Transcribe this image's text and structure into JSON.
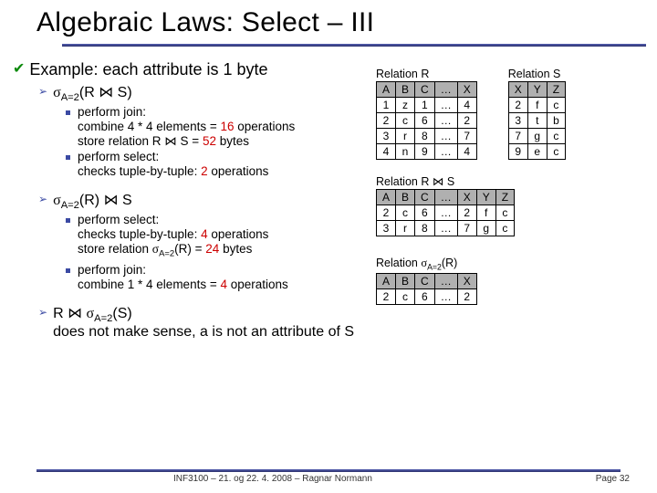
{
  "title": "Algebraic Laws: Select – III",
  "example_heading": "Example: each attribute is 1 byte",
  "expr1": "σA=2(R ⋈ S)",
  "expr1_bullets": [
    "perform join:\ncombine 4 * 4 elements = 16 operations\nstore relation R ⋈ S = 52 bytes",
    "perform select:\nchecks tuple-by-tuple: 2 operations"
  ],
  "expr2": "σA=2(R) ⋈ S",
  "expr2_bullets": [
    "perform select:\nchecks tuple-by-tuple: 4 operations\nstore relation σA=2(R) = 24 bytes",
    "perform join:\ncombine 1 * 4 elements = 4 operations"
  ],
  "expr3_line": "R ⋈ σA=2(S)\ndoes not make sense, a is not an attribute of S",
  "tables": {
    "R": {
      "label": "Relation R",
      "head": [
        "A",
        "B",
        "C",
        "…",
        "X"
      ],
      "rows": [
        [
          "1",
          "z",
          "1",
          "…",
          "4"
        ],
        [
          "2",
          "c",
          "6",
          "…",
          "2"
        ],
        [
          "3",
          "r",
          "8",
          "…",
          "7"
        ],
        [
          "4",
          "n",
          "9",
          "…",
          "4"
        ]
      ]
    },
    "S": {
      "label": "Relation S",
      "head": [
        "X",
        "Y",
        "Z"
      ],
      "rows": [
        [
          "2",
          "f",
          "c"
        ],
        [
          "3",
          "t",
          "b"
        ],
        [
          "7",
          "g",
          "c"
        ],
        [
          "9",
          "e",
          "c"
        ]
      ]
    },
    "RS": {
      "label": "Relation R ⋈ S",
      "head": [
        "A",
        "B",
        "C",
        "…",
        "X",
        "Y",
        "Z"
      ],
      "rows": [
        [
          "2",
          "c",
          "6",
          "…",
          "2",
          "f",
          "c"
        ],
        [
          "3",
          "r",
          "8",
          "…",
          "7",
          "g",
          "c"
        ]
      ]
    },
    "sigmaR": {
      "label": "Relation σA=2(R)",
      "head": [
        "A",
        "B",
        "C",
        "…",
        "X"
      ],
      "rows": [
        [
          "2",
          "c",
          "6",
          "…",
          "2"
        ]
      ]
    }
  },
  "footer_center": "INF3100 – 21. og 22. 4. 2008 – Ragnar Normann",
  "footer_right": "Page 32"
}
